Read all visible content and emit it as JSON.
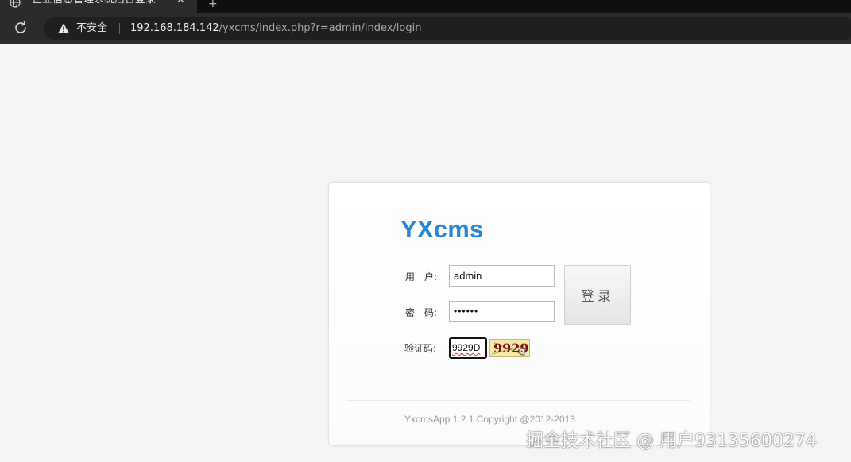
{
  "browser": {
    "tab": {
      "title": "企业信息管理系统后台登录",
      "close_icon": "close-icon",
      "favicon": "globe-icon"
    },
    "new_tab_icon": "new-tab-icon",
    "reload_icon": "reload-icon",
    "security": {
      "icon": "warning-icon",
      "label": "不安全"
    },
    "url": {
      "host": "192.168.184.142",
      "path": "/yxcms/index.php?r=admin/index/login"
    }
  },
  "login": {
    "brand": "YXcms",
    "brand_color": "#2a86d2",
    "username_label": "用　户:",
    "username_value": "admin",
    "password_label": "密　码:",
    "password_value": "••••••",
    "captcha_label": "验证码:",
    "captcha_value": "9929D",
    "captcha_image_text": "9929",
    "submit_label": "登录",
    "copyright": "YxcmsApp 1.2.1 Copyright @2012-2013"
  },
  "watermark": "掘金技术社区 @ 用户93135600274"
}
